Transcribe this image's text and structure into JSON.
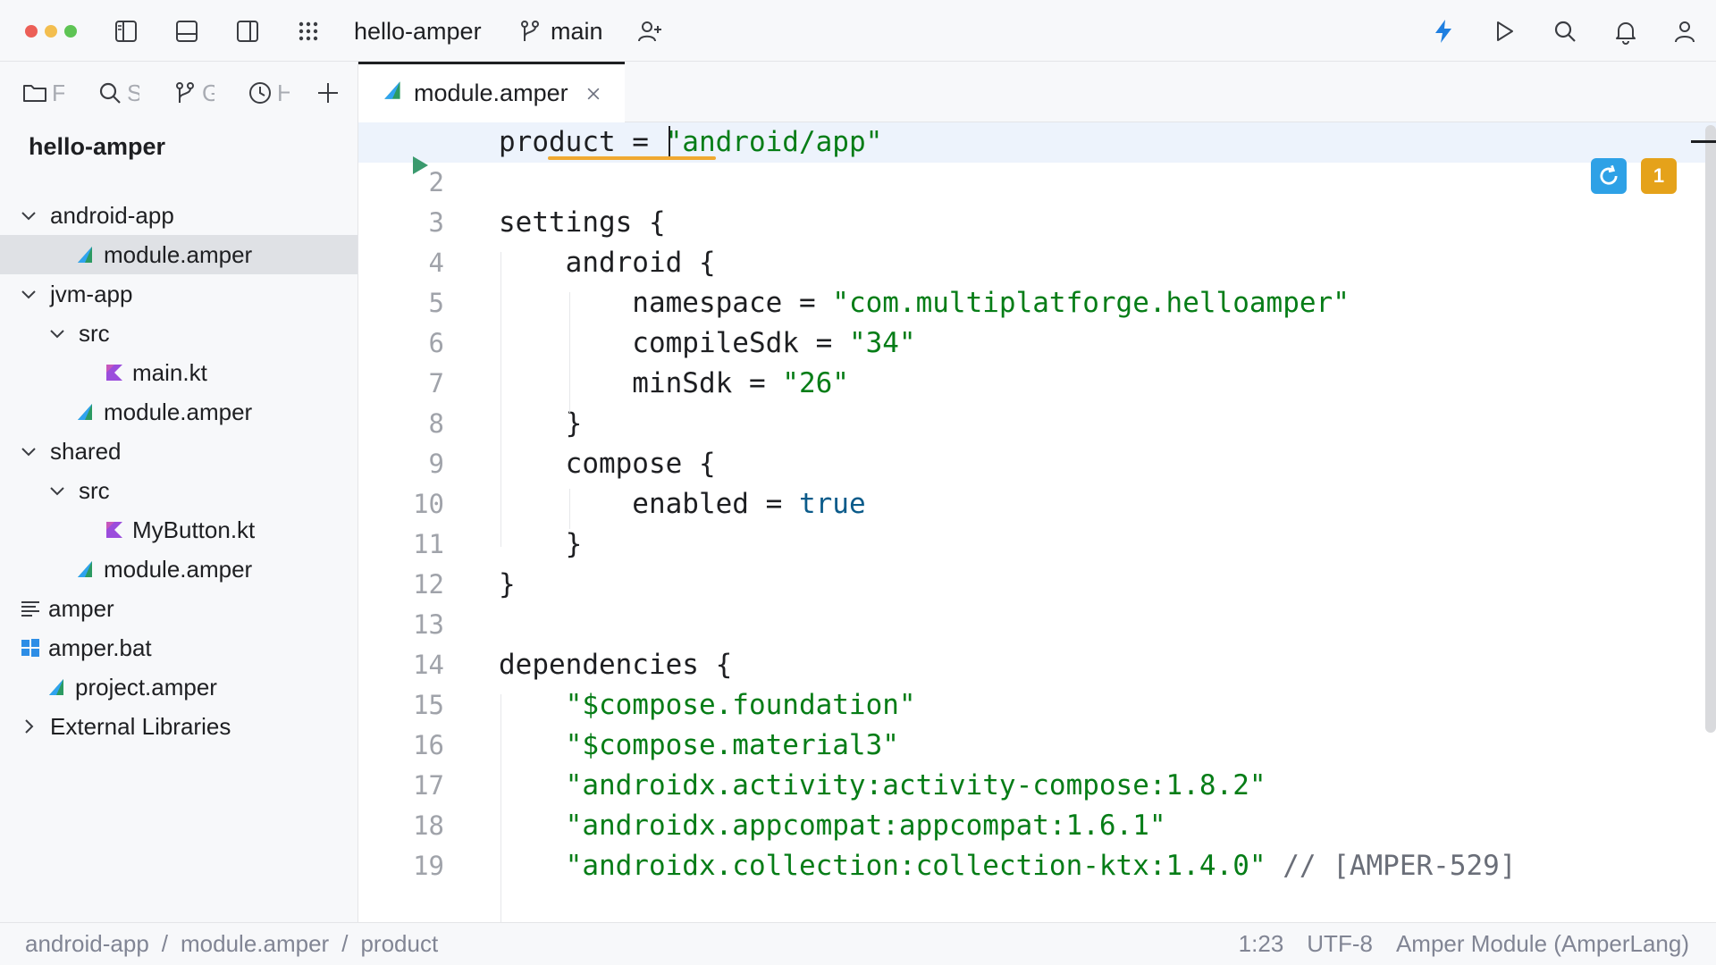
{
  "toolbar": {
    "project_name": "hello-amper",
    "branch": "main"
  },
  "sidebar": {
    "tabs": [
      {
        "icon": "folder-icon",
        "label": "F"
      },
      {
        "icon": "search-icon",
        "label": "S"
      },
      {
        "icon": "git-branch-icon",
        "label": "G"
      },
      {
        "icon": "clock-icon",
        "label": "H"
      }
    ],
    "root": "hello-amper",
    "tree": [
      {
        "label": "android-app",
        "icon": "none",
        "expander": "down",
        "depth": 0
      },
      {
        "label": "module.amper",
        "icon": "amper-file-icon",
        "expander": "none",
        "depth": 1,
        "selected": true
      },
      {
        "label": "jvm-app",
        "icon": "none",
        "expander": "down",
        "depth": 0
      },
      {
        "label": "src",
        "icon": "none",
        "expander": "down",
        "depth": 1
      },
      {
        "label": "main.kt",
        "icon": "kotlin-file-icon",
        "expander": "none",
        "depth": 2
      },
      {
        "label": "module.amper",
        "icon": "amper-file-icon",
        "expander": "none",
        "depth": 1
      },
      {
        "label": "shared",
        "icon": "none",
        "expander": "down",
        "depth": 0
      },
      {
        "label": "src",
        "icon": "none",
        "expander": "down",
        "depth": 1
      },
      {
        "label": "MyButton.kt",
        "icon": "kotlin-file-icon",
        "expander": "none",
        "depth": 2
      },
      {
        "label": "module.amper",
        "icon": "amper-file-icon",
        "expander": "none",
        "depth": 1
      },
      {
        "label": "amper",
        "icon": "text-file-icon",
        "expander": "none",
        "depth": 0
      },
      {
        "label": "amper.bat",
        "icon": "windows-file-icon",
        "expander": "none",
        "depth": 0
      },
      {
        "label": "project.amper",
        "icon": "amper-file-icon",
        "expander": "none",
        "depth": 0
      },
      {
        "label": "External Libraries",
        "icon": "none",
        "expander": "right",
        "depth": 0
      }
    ]
  },
  "editor": {
    "tab_name": "module.amper",
    "badge_count": "1",
    "lines": [
      {
        "n": "",
        "code": [
          {
            "t": "product = ",
            "c": ""
          },
          {
            "t": "\"android/app\"",
            "c": "str"
          }
        ]
      },
      {
        "n": "2",
        "code": []
      },
      {
        "n": "3",
        "code": [
          {
            "t": "settings {",
            "c": ""
          }
        ]
      },
      {
        "n": "4",
        "code": [
          {
            "t": "    android {",
            "c": ""
          }
        ]
      },
      {
        "n": "5",
        "code": [
          {
            "t": "        namespace = ",
            "c": ""
          },
          {
            "t": "\"com.multiplatforge.helloamper\"",
            "c": "str"
          }
        ]
      },
      {
        "n": "6",
        "code": [
          {
            "t": "        compileSdk = ",
            "c": ""
          },
          {
            "t": "\"34\"",
            "c": "str"
          }
        ]
      },
      {
        "n": "7",
        "code": [
          {
            "t": "        minSdk = ",
            "c": ""
          },
          {
            "t": "\"26\"",
            "c": "str"
          }
        ]
      },
      {
        "n": "8",
        "code": [
          {
            "t": "    }",
            "c": ""
          }
        ]
      },
      {
        "n": "9",
        "code": [
          {
            "t": "    compose {",
            "c": ""
          }
        ]
      },
      {
        "n": "10",
        "code": [
          {
            "t": "        enabled = ",
            "c": ""
          },
          {
            "t": "true",
            "c": "kw"
          }
        ]
      },
      {
        "n": "11",
        "code": [
          {
            "t": "    }",
            "c": ""
          }
        ]
      },
      {
        "n": "12",
        "code": [
          {
            "t": "}",
            "c": ""
          }
        ]
      },
      {
        "n": "13",
        "code": []
      },
      {
        "n": "14",
        "code": [
          {
            "t": "dependencies {",
            "c": ""
          }
        ]
      },
      {
        "n": "15",
        "code": [
          {
            "t": "    ",
            "c": ""
          },
          {
            "t": "\"$compose.foundation\"",
            "c": "str"
          }
        ]
      },
      {
        "n": "16",
        "code": [
          {
            "t": "    ",
            "c": ""
          },
          {
            "t": "\"$compose.material3\"",
            "c": "str"
          }
        ]
      },
      {
        "n": "17",
        "code": [
          {
            "t": "    ",
            "c": ""
          },
          {
            "t": "\"androidx.activity:activity-compose:1.8.2\"",
            "c": "str"
          }
        ]
      },
      {
        "n": "18",
        "code": [
          {
            "t": "    ",
            "c": ""
          },
          {
            "t": "\"androidx.appcompat:appcompat:1.6.1\"",
            "c": "str"
          }
        ]
      },
      {
        "n": "19",
        "code": [
          {
            "t": "    ",
            "c": ""
          },
          {
            "t": "\"androidx.collection:collection-ktx:1.4.0\"",
            "c": "str"
          },
          {
            "t": " // [AMPER-529]",
            "c": "cmt"
          }
        ]
      }
    ]
  },
  "statusbar": {
    "breadcrumbs": [
      "android-app",
      "module.amper",
      "product"
    ],
    "separator": "/",
    "position": "1:23",
    "encoding": "UTF-8",
    "language": "Amper Module (AmperLang)"
  },
  "colors": {
    "accent": "#1f7fe0",
    "warning_badge": "#e5a21a",
    "string": "#067d17",
    "keyword": "#0b5b8a"
  }
}
